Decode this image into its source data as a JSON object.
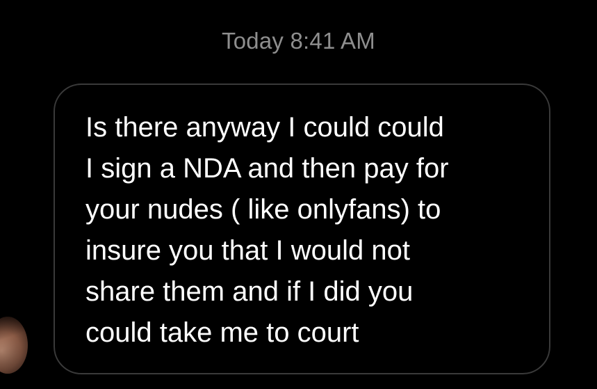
{
  "conversation": {
    "timestamp": "Today 8:41 AM",
    "message": {
      "lines": [
        "Is there anyway I could could",
        "I sign a NDA and then pay for",
        "your nudes ( like onlyfans) to",
        "insure you that I would not",
        "share them and if I did you",
        "could take me to court"
      ]
    }
  },
  "colors": {
    "background": "#000000",
    "timestamp_text": "#8e8e8e",
    "bubble_border": "#3a3a3a",
    "message_text": "#ffffff"
  }
}
